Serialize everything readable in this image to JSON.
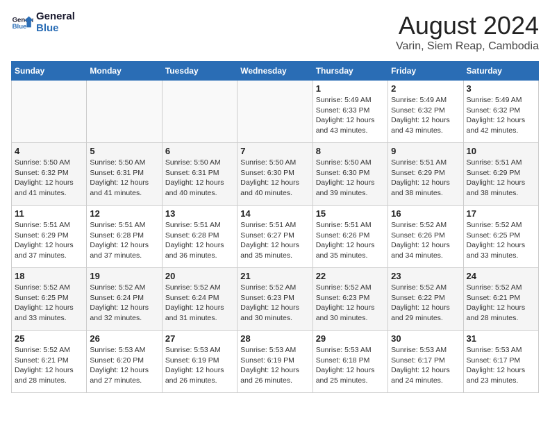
{
  "logo": {
    "line1": "General",
    "line2": "Blue"
  },
  "title": "August 2024",
  "location": "Varin, Siem Reap, Cambodia",
  "days_of_week": [
    "Sunday",
    "Monday",
    "Tuesday",
    "Wednesday",
    "Thursday",
    "Friday",
    "Saturday"
  ],
  "weeks": [
    [
      {
        "day": "",
        "info": ""
      },
      {
        "day": "",
        "info": ""
      },
      {
        "day": "",
        "info": ""
      },
      {
        "day": "",
        "info": ""
      },
      {
        "day": "1",
        "info": "Sunrise: 5:49 AM\nSunset: 6:33 PM\nDaylight: 12 hours\nand 43 minutes."
      },
      {
        "day": "2",
        "info": "Sunrise: 5:49 AM\nSunset: 6:32 PM\nDaylight: 12 hours\nand 43 minutes."
      },
      {
        "day": "3",
        "info": "Sunrise: 5:49 AM\nSunset: 6:32 PM\nDaylight: 12 hours\nand 42 minutes."
      }
    ],
    [
      {
        "day": "4",
        "info": "Sunrise: 5:50 AM\nSunset: 6:32 PM\nDaylight: 12 hours\nand 41 minutes."
      },
      {
        "day": "5",
        "info": "Sunrise: 5:50 AM\nSunset: 6:31 PM\nDaylight: 12 hours\nand 41 minutes."
      },
      {
        "day": "6",
        "info": "Sunrise: 5:50 AM\nSunset: 6:31 PM\nDaylight: 12 hours\nand 40 minutes."
      },
      {
        "day": "7",
        "info": "Sunrise: 5:50 AM\nSunset: 6:30 PM\nDaylight: 12 hours\nand 40 minutes."
      },
      {
        "day": "8",
        "info": "Sunrise: 5:50 AM\nSunset: 6:30 PM\nDaylight: 12 hours\nand 39 minutes."
      },
      {
        "day": "9",
        "info": "Sunrise: 5:51 AM\nSunset: 6:29 PM\nDaylight: 12 hours\nand 38 minutes."
      },
      {
        "day": "10",
        "info": "Sunrise: 5:51 AM\nSunset: 6:29 PM\nDaylight: 12 hours\nand 38 minutes."
      }
    ],
    [
      {
        "day": "11",
        "info": "Sunrise: 5:51 AM\nSunset: 6:29 PM\nDaylight: 12 hours\nand 37 minutes."
      },
      {
        "day": "12",
        "info": "Sunrise: 5:51 AM\nSunset: 6:28 PM\nDaylight: 12 hours\nand 37 minutes."
      },
      {
        "day": "13",
        "info": "Sunrise: 5:51 AM\nSunset: 6:28 PM\nDaylight: 12 hours\nand 36 minutes."
      },
      {
        "day": "14",
        "info": "Sunrise: 5:51 AM\nSunset: 6:27 PM\nDaylight: 12 hours\nand 35 minutes."
      },
      {
        "day": "15",
        "info": "Sunrise: 5:51 AM\nSunset: 6:26 PM\nDaylight: 12 hours\nand 35 minutes."
      },
      {
        "day": "16",
        "info": "Sunrise: 5:52 AM\nSunset: 6:26 PM\nDaylight: 12 hours\nand 34 minutes."
      },
      {
        "day": "17",
        "info": "Sunrise: 5:52 AM\nSunset: 6:25 PM\nDaylight: 12 hours\nand 33 minutes."
      }
    ],
    [
      {
        "day": "18",
        "info": "Sunrise: 5:52 AM\nSunset: 6:25 PM\nDaylight: 12 hours\nand 33 minutes."
      },
      {
        "day": "19",
        "info": "Sunrise: 5:52 AM\nSunset: 6:24 PM\nDaylight: 12 hours\nand 32 minutes."
      },
      {
        "day": "20",
        "info": "Sunrise: 5:52 AM\nSunset: 6:24 PM\nDaylight: 12 hours\nand 31 minutes."
      },
      {
        "day": "21",
        "info": "Sunrise: 5:52 AM\nSunset: 6:23 PM\nDaylight: 12 hours\nand 30 minutes."
      },
      {
        "day": "22",
        "info": "Sunrise: 5:52 AM\nSunset: 6:23 PM\nDaylight: 12 hours\nand 30 minutes."
      },
      {
        "day": "23",
        "info": "Sunrise: 5:52 AM\nSunset: 6:22 PM\nDaylight: 12 hours\nand 29 minutes."
      },
      {
        "day": "24",
        "info": "Sunrise: 5:52 AM\nSunset: 6:21 PM\nDaylight: 12 hours\nand 28 minutes."
      }
    ],
    [
      {
        "day": "25",
        "info": "Sunrise: 5:52 AM\nSunset: 6:21 PM\nDaylight: 12 hours\nand 28 minutes."
      },
      {
        "day": "26",
        "info": "Sunrise: 5:53 AM\nSunset: 6:20 PM\nDaylight: 12 hours\nand 27 minutes."
      },
      {
        "day": "27",
        "info": "Sunrise: 5:53 AM\nSunset: 6:19 PM\nDaylight: 12 hours\nand 26 minutes."
      },
      {
        "day": "28",
        "info": "Sunrise: 5:53 AM\nSunset: 6:19 PM\nDaylight: 12 hours\nand 26 minutes."
      },
      {
        "day": "29",
        "info": "Sunrise: 5:53 AM\nSunset: 6:18 PM\nDaylight: 12 hours\nand 25 minutes."
      },
      {
        "day": "30",
        "info": "Sunrise: 5:53 AM\nSunset: 6:17 PM\nDaylight: 12 hours\nand 24 minutes."
      },
      {
        "day": "31",
        "info": "Sunrise: 5:53 AM\nSunset: 6:17 PM\nDaylight: 12 hours\nand 23 minutes."
      }
    ]
  ]
}
